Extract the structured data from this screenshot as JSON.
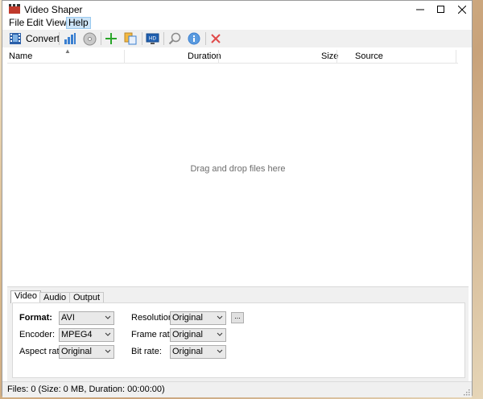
{
  "window": {
    "title": "Video Shaper"
  },
  "menu": {
    "items": [
      "File",
      "Edit",
      "View",
      "Help"
    ]
  },
  "toolbar": {
    "convert_label": "Convert"
  },
  "list": {
    "columns": [
      "Name",
      "Duration",
      "Size",
      "Source"
    ],
    "empty_hint": "Drag and drop files here"
  },
  "settings": {
    "tabs": [
      "Video",
      "Audio",
      "Output"
    ],
    "format_label": "Format:",
    "format_value": "AVI",
    "encoder_label": "Encoder:",
    "encoder_value": "MPEG4",
    "aspect_label": "Aspect ratio:",
    "aspect_value": "Original",
    "resolution_label": "Resolution:",
    "resolution_value": "Original",
    "resolution_more": "...",
    "framerate_label": "Frame rate:",
    "framerate_value": "Original",
    "bitrate_label": "Bit rate:",
    "bitrate_value": "Original"
  },
  "status": {
    "text": "Files: 0 (Size: 0 MB, Duration: 00:00:00)"
  },
  "colors": {
    "accent_blue": "#3a7fd0",
    "add_green": "#2aa52a",
    "remove_red": "#e04a4a",
    "chrome": "#f0f0f0"
  }
}
